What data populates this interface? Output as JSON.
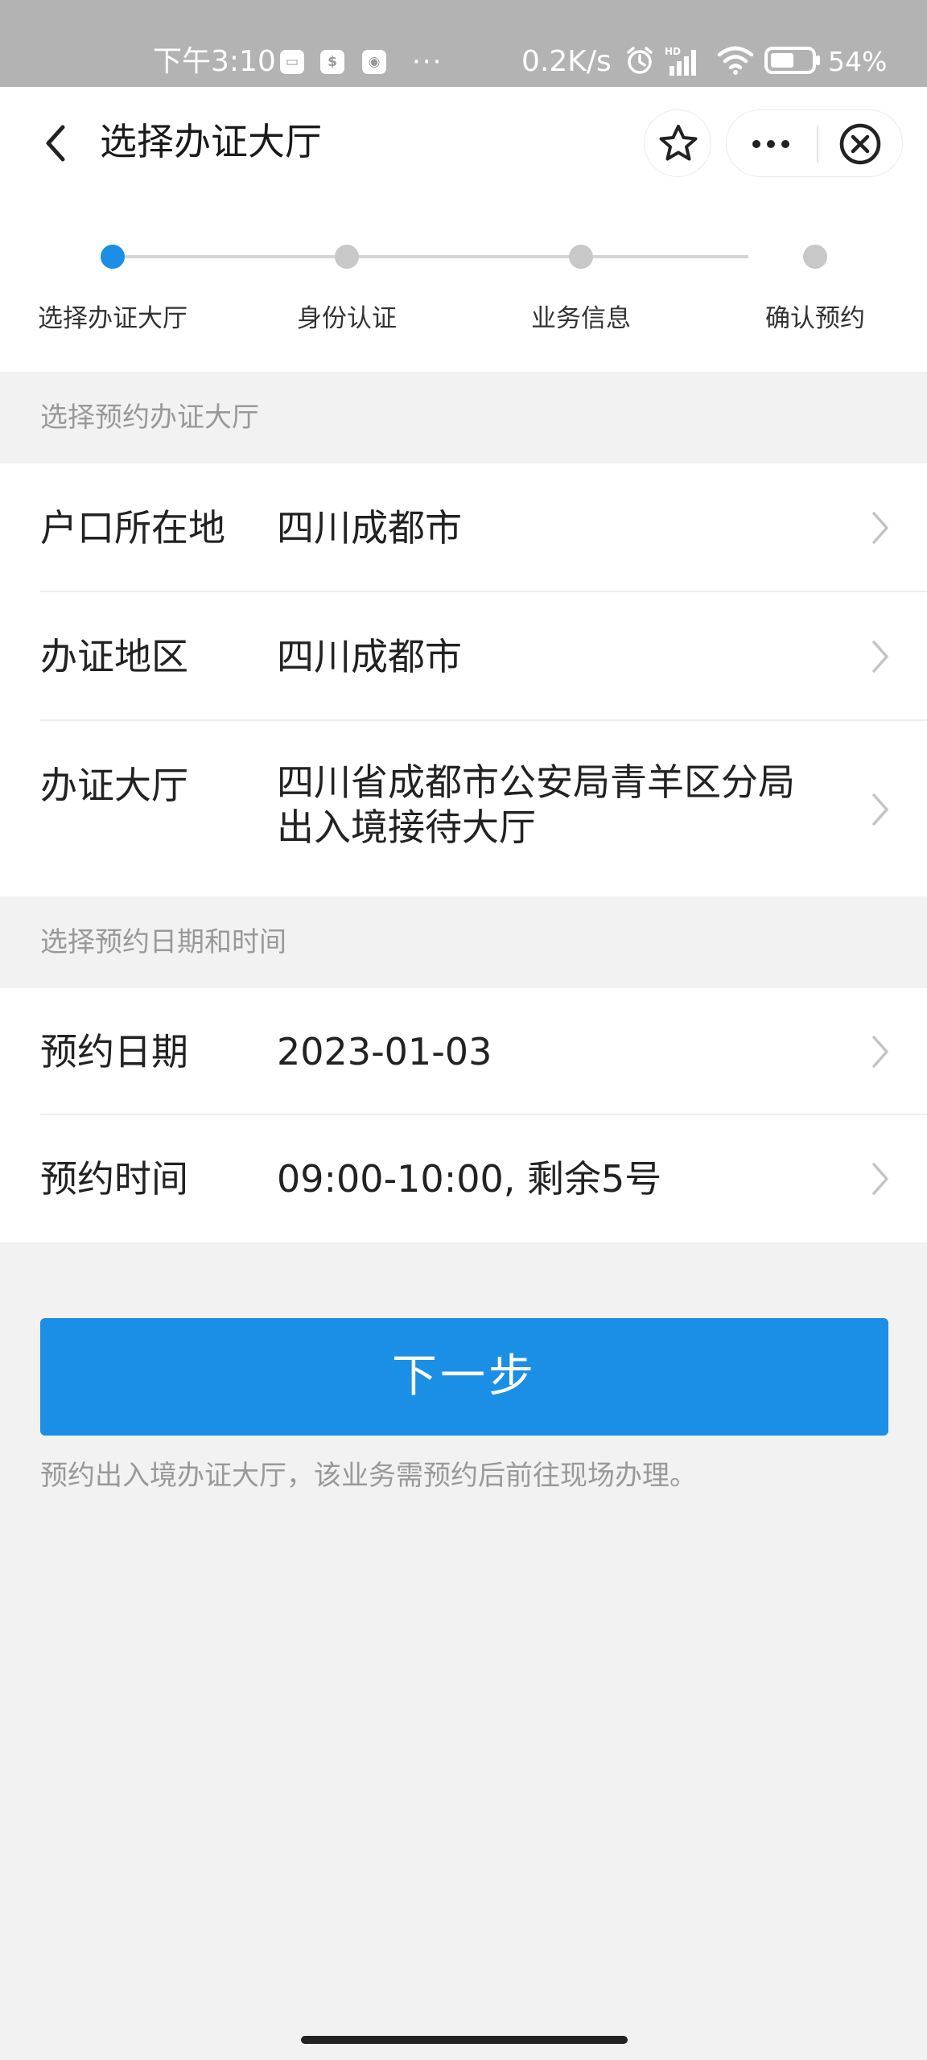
{
  "status_bar": {
    "time": "下午3:10",
    "notification_icons": [
      "message-icon",
      "money-icon",
      "app-icon"
    ],
    "overflow": "···",
    "network_speed": "0.2K/s",
    "battery_percent": "54%"
  },
  "nav": {
    "title": "选择办证大厅",
    "back_icon": "chevron-left-icon",
    "favorite_icon": "star-icon",
    "more_icon": "more-icon",
    "close_icon": "close-circle-icon"
  },
  "stepper": {
    "steps": [
      {
        "label": "选择办证大厅",
        "active": true
      },
      {
        "label": "身份认证",
        "active": false
      },
      {
        "label": "业务信息",
        "active": false
      },
      {
        "label": "确认预约",
        "active": false
      }
    ]
  },
  "hall_section": {
    "header": "选择预约办证大厅",
    "rows": [
      {
        "label": "户口所在地",
        "value": "四川成都市"
      },
      {
        "label": "办证地区",
        "value": "四川成都市"
      },
      {
        "label": "办证大厅",
        "value_line1": "四川省成都市公安局青羊区分局",
        "value_line2": "出入境接待大厅"
      }
    ]
  },
  "datetime_section": {
    "header": "选择预约日期和时间",
    "rows": [
      {
        "label": "预约日期",
        "value": "2023-01-03"
      },
      {
        "label": "预约时间",
        "value": "09:00-10:00, 剩余5号"
      }
    ]
  },
  "next_button": {
    "label": "下一步"
  },
  "notice": "预约出入境办证大厅，该业务需预约后前往现场办理。",
  "colors": {
    "accent": "#1b8fe6",
    "status_bar": "#b3b3b3",
    "background": "#f2f2f2"
  }
}
